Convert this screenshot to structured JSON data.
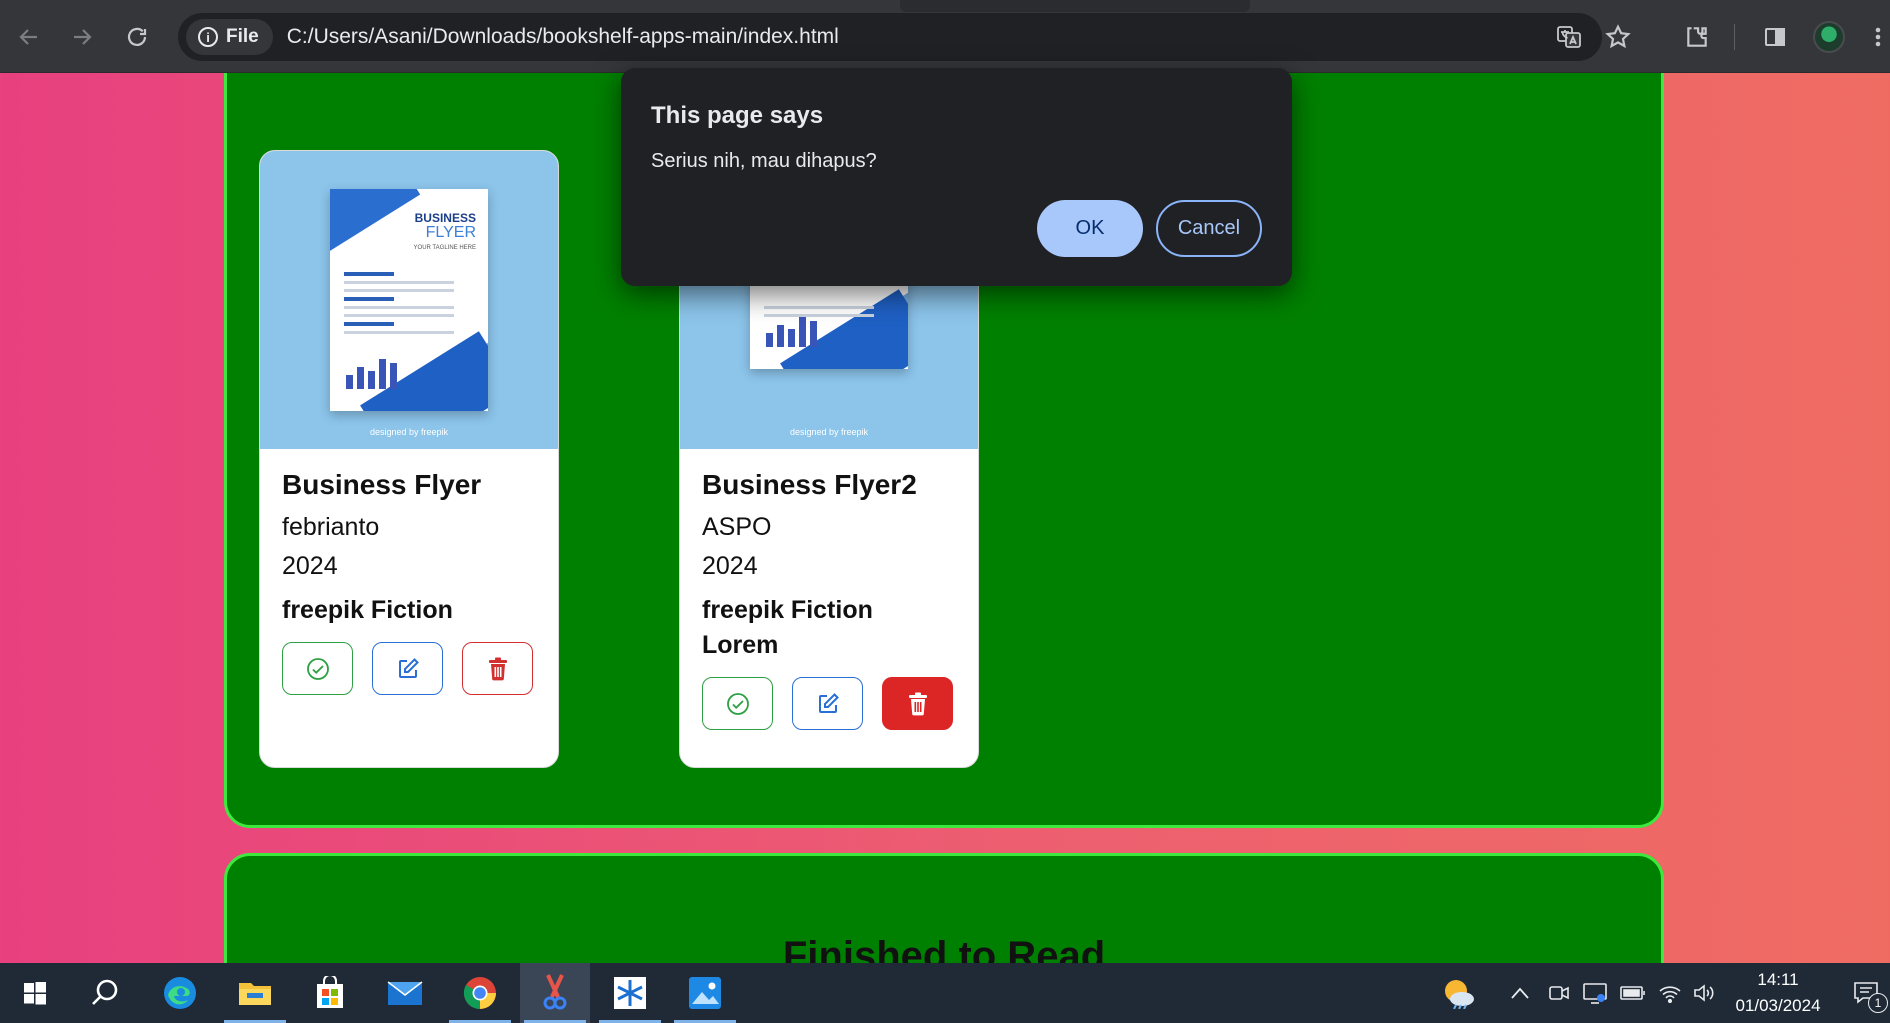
{
  "browser": {
    "chip_label": "File",
    "url": "C:/Users/Asani/Downloads/bookshelf-apps-main/index.html"
  },
  "dialog": {
    "title": "This page says",
    "message": "Serius nih, mau dihapus?",
    "ok_label": "OK",
    "cancel_label": "Cancel"
  },
  "books": [
    {
      "title": "Business Flyer",
      "author": "febrianto",
      "year": "2024",
      "category": "freepik Fiction",
      "cover": {
        "brand": "BUSINESS",
        "subtitle": "FLYER",
        "tagline": "YOUR TAGLINE HERE",
        "credit": "designed by freepik"
      }
    },
    {
      "title": "Business Flyer2",
      "author": "ASPO",
      "year": "2024",
      "category": "freepik Fiction Lorem",
      "cover": {
        "credit": "designed by freepik"
      }
    }
  ],
  "sections": {
    "finished_heading": "Finished to Read"
  },
  "taskbar": {
    "time": "14:11",
    "date": "01/03/2024",
    "notification_count": "1"
  },
  "colors": {
    "section_bg": "#008000",
    "section_border": "#3ce93c",
    "delete_red": "#dc2626",
    "edit_blue": "#2a6fd6",
    "check_green": "#2ea043"
  }
}
